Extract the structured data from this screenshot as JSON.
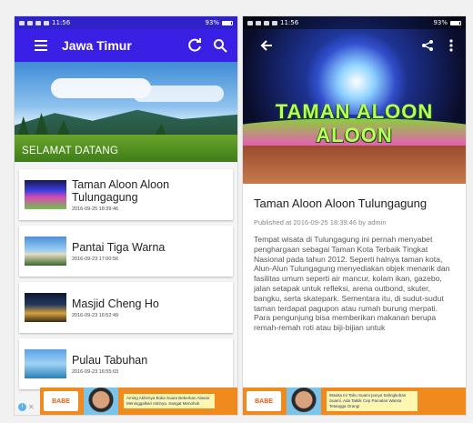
{
  "left": {
    "status": {
      "time": "11:56",
      "battery": "93%"
    },
    "appbar": {
      "title": "Jawa Timur",
      "menu_icon": "menu-icon",
      "refresh_icon": "refresh-icon",
      "search_icon": "search-icon"
    },
    "hero": {
      "caption": "SELAMAT DATANG"
    },
    "items": [
      {
        "title": "Taman Aloon Aloon Tulungagung",
        "date": "2016-09-25 18:39:46"
      },
      {
        "title": "Pantai Tiga Warna",
        "date": "2016-09-23 17:00:56"
      },
      {
        "title": "Masjid Cheng Ho",
        "date": "2016-09-23 16:52:49"
      },
      {
        "title": "Pulau Tabuhan",
        "date": "2016-09-23 16:55:03"
      }
    ],
    "ad": {
      "logo": "BABE",
      "text": "Aming Akhirnya Buka Suara Beberkan Alasan Meninggalkan Istrinya. Sangat Menohok"
    }
  },
  "right": {
    "status": {
      "time": "11:56",
      "battery": "93%"
    },
    "toolbar": {
      "back_icon": "arrow-left-icon",
      "share_icon": "share-icon",
      "more_icon": "more-vert-icon"
    },
    "hero": {
      "sign_text": "TAMAN ALOON ALOON"
    },
    "article": {
      "title": "Taman Aloon Aloon Tulungagung",
      "meta": "Published at 2016-09-25 18:39:46 by admin",
      "body": "Tempat wisata di Tulungagung ini pernah menyabet penghargaan sebagai Taman Kota Terbaik Tingkat Nasional pada tahun 2012. Seperti halnya taman kota, Alun-Alun Tulungagung menyediakan objek menarik dan fasilitas umum seperti air mancur, kolam ikan, gazebo, jalan setapak untuk refleksi, arena outbond, skuter, bangku, serta skatepark. Sementara itu, di sudut-sudut taman terdapat pagupon atau rumah burung merpati. Para pengunjung bisa memberikan makanan berupa remah-remah roti atau biji-bijian untuk"
    },
    "ad": {
      "logo": "BABE",
      "text": "Wanita Ini Tahu Suami punya Selingkuhan Suami. Ada Taktik Cep Pamalan Wanita Tetangga Orang!"
    }
  },
  "colors": {
    "appbar": "#3a20e4",
    "statusbar": "#2f22c9",
    "ad": "#f08a1e"
  }
}
